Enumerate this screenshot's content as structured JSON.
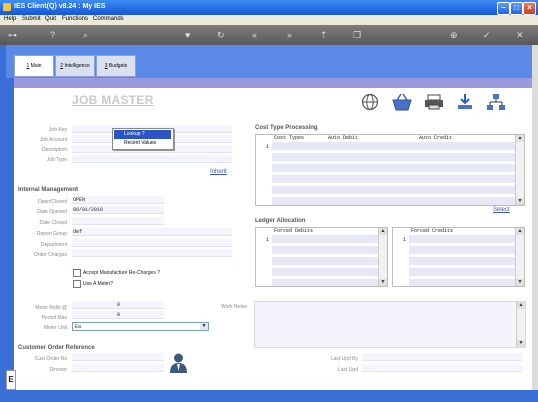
{
  "window": {
    "title": "IES Client(Q) v8.24 : My IES"
  },
  "menu": [
    "Help",
    "Submit",
    "Quit",
    "Functions",
    "Commands"
  ],
  "tabs": [
    {
      "num": "1",
      "label": "Main"
    },
    {
      "num": "2",
      "label": "Intelligence"
    },
    {
      "num": "3",
      "label": "Budgets"
    }
  ],
  "page": {
    "title": "JOB MASTER"
  },
  "form": {
    "job_key_label": "Job Key",
    "job_account_label": "Job Account",
    "description_label": "Description",
    "job_type_label": "Job Type",
    "inherit_link": "Inherit"
  },
  "lookup_menu": {
    "items": [
      "Lookup ?",
      "Recent Values"
    ]
  },
  "internal": {
    "heading": "Internal Management",
    "open_closed_label": "Open/Closed",
    "open_closed_value": "OPEN",
    "date_opened_label": "Date Opened",
    "date_opened_value": "06/01/2010",
    "date_closed_label": "Date Closed",
    "report_group_label": "Report Group",
    "report_group_value": "def",
    "department_label": "Department",
    "order_charges_label": "Order Charges",
    "accept_manufacture_label": "Accept Manufacture Re-Charges ?",
    "use_meter_label": "Use A Meter?"
  },
  "meter": {
    "meter_rolls_label": "Meter Rolls @",
    "meter_rolls_value": "0",
    "period_max_label": "Period Max",
    "period_max_value": "0",
    "meter_unit_label": "Meter Unit",
    "meter_unit_value": "Ea"
  },
  "work_notes_label": "Work Notes",
  "cost_type": {
    "heading": "Cost Type Processing",
    "columns": [
      "Cost Types",
      "Auto Debit",
      "Auto Credit"
    ],
    "row_number": "1",
    "select_link": "Select"
  },
  "ledger": {
    "heading": "Ledger Allocation",
    "debits_header": "Forced Debits",
    "credits_header": "Forced Credits",
    "row_number": "1"
  },
  "customer_order": {
    "heading": "Customer Order Reference",
    "cust_order_no_label": "Cust Order No",
    "director_label": "Director",
    "last_upd_by_label": "Last Upd By",
    "last_upd_label": "Last Upd"
  },
  "icons": [
    "globe-icon",
    "basket-icon",
    "printer-icon",
    "download-icon",
    "network-icon",
    "person-icon"
  ]
}
